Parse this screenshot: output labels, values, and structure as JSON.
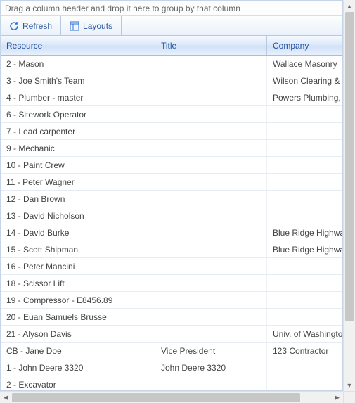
{
  "groupByHint": "Drag a column header and drop it here to group by that column",
  "toolbar": {
    "refresh": "Refresh",
    "layouts": "Layouts"
  },
  "columns": {
    "resource": "Resource",
    "title": "Title",
    "company": "Company"
  },
  "rows": [
    {
      "resource": "2 - Mason",
      "title": "",
      "company": "Wallace Masonry"
    },
    {
      "resource": "3 - Joe Smith's Team",
      "title": "",
      "company": "Wilson Clearing & D"
    },
    {
      "resource": "4 - Plumber - master",
      "title": "",
      "company": "Powers Plumbing, In"
    },
    {
      "resource": "6 - Sitework Operator",
      "title": "",
      "company": ""
    },
    {
      "resource": "7 - Lead carpenter",
      "title": "",
      "company": ""
    },
    {
      "resource": "9 - Mechanic",
      "title": "",
      "company": ""
    },
    {
      "resource": "10 - Paint Crew",
      "title": "",
      "company": ""
    },
    {
      "resource": "11 - Peter Wagner",
      "title": "",
      "company": ""
    },
    {
      "resource": "12 - Dan Brown",
      "title": "",
      "company": ""
    },
    {
      "resource": "13 - David Nicholson",
      "title": "",
      "company": ""
    },
    {
      "resource": "14 - David Burke",
      "title": "",
      "company": "Blue Ridge Highway"
    },
    {
      "resource": "15 - Scott Shipman",
      "title": "",
      "company": "Blue Ridge Highway"
    },
    {
      "resource": "16 - Peter Mancini",
      "title": "",
      "company": ""
    },
    {
      "resource": "18 - Scissor Lift",
      "title": "",
      "company": ""
    },
    {
      "resource": "19 - Compressor - E8456.89",
      "title": "",
      "company": ""
    },
    {
      "resource": "20 - Euan Samuels Brusse",
      "title": "",
      "company": ""
    },
    {
      "resource": "21 - Alyson Davis",
      "title": "",
      "company": "Univ. of Washington"
    },
    {
      "resource": "CB - Jane Doe",
      "title": "Vice President",
      "company": "123 Contractor"
    },
    {
      "resource": "1 - John Deere 3320",
      "title": "John Deere 3320",
      "company": ""
    },
    {
      "resource": "2 - Excavator",
      "title": "",
      "company": ""
    }
  ]
}
